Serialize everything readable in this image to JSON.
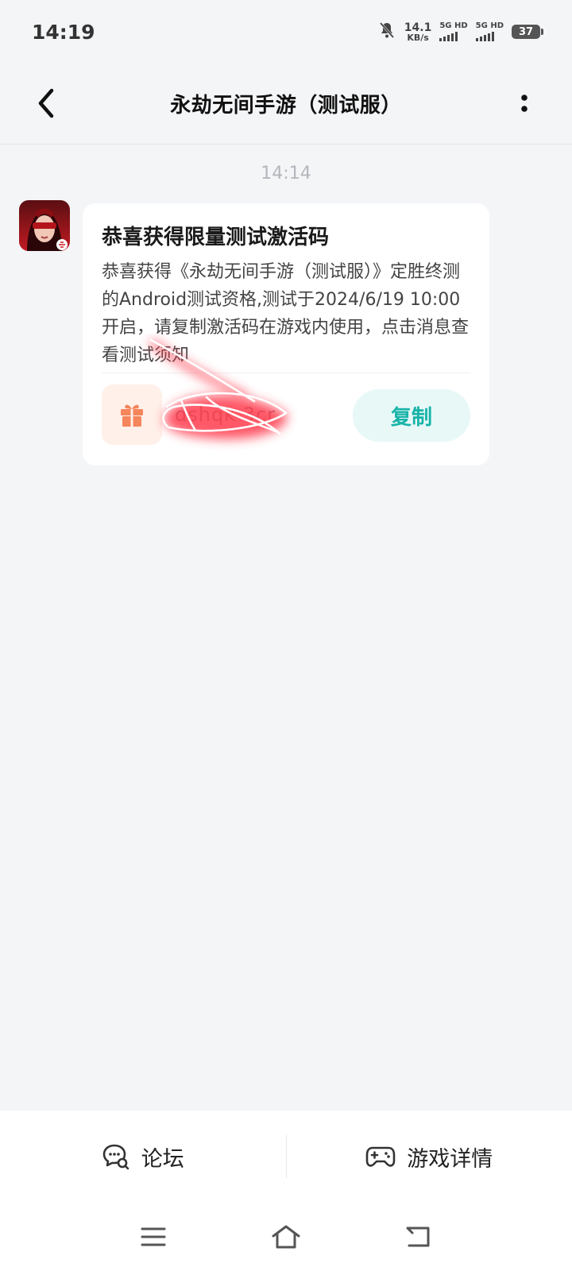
{
  "status_bar": {
    "time": "14:19",
    "net_speed_value": "14.1",
    "net_speed_unit": "KB/s",
    "sim1_label": "5G HD",
    "sim2_label": "5G HD",
    "battery": "37"
  },
  "header": {
    "title": "永劫无间手游（测试服）"
  },
  "messages": [
    {
      "time": "14:14",
      "card_title": "恭喜获得限量测试激活码",
      "card_body": "恭喜获得《永劫无间手游（测试服）》定胜终测的Android测试资格,测试于2024/6/19 10:00 开启，请复制激活码在游戏内使用，点击消息查看测试须知",
      "code_visible": "dshqk   3cr",
      "copy_label": "复制"
    }
  ],
  "bottom_tabs": [
    {
      "label": "论坛",
      "icon": "forum-icon"
    },
    {
      "label": "游戏详情",
      "icon": "gamepad-icon"
    }
  ],
  "colors": {
    "accent_teal": "#17b3a8",
    "gift_orange": "#f5855b",
    "background": "#f4f5f7"
  }
}
